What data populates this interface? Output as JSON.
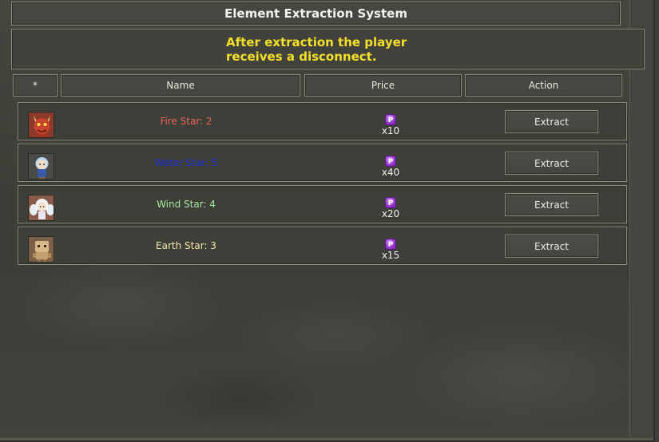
{
  "window": {
    "title": "Element Extraction System",
    "notice_line1": "After extraction the player",
    "notice_line2": "receives a disconnect."
  },
  "table": {
    "headers": {
      "star": "*",
      "name": "Name",
      "price": "Price",
      "action": "Action"
    },
    "rows": [
      {
        "name": "Fire Star: 2",
        "color": "#e8625c",
        "icon": "fire-demon-icon",
        "currency": "P",
        "qty": "x10",
        "action": "Extract"
      },
      {
        "name": "Water Star: 5",
        "color": "#1a2fd6",
        "icon": "water-fairy-icon",
        "currency": "P",
        "qty": "x40",
        "action": "Extract"
      },
      {
        "name": "Wind Star: 4",
        "color": "#a8e6a0",
        "icon": "wind-angel-icon",
        "currency": "P",
        "qty": "x20",
        "action": "Extract"
      },
      {
        "name": "Earth Star: 3",
        "color": "#f0e6a8",
        "icon": "earth-golem-icon",
        "currency": "P",
        "qty": "x15",
        "action": "Extract"
      }
    ]
  }
}
